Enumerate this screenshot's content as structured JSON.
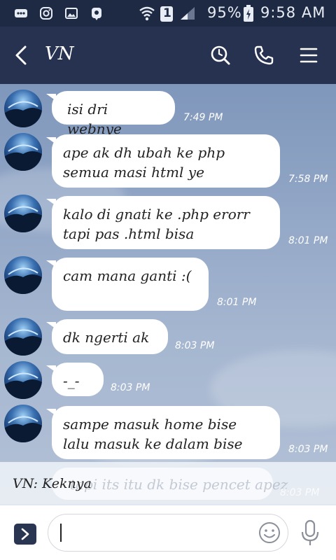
{
  "status_bar": {
    "battery": "95%",
    "time": "9:58 AM",
    "sim": "1"
  },
  "header": {
    "title": "VN",
    "icons": [
      "back-arrow-icon",
      "search-icon",
      "phone-icon",
      "menu-icon"
    ]
  },
  "messages": [
    {
      "text_lines": [
        "isi dri webnye"
      ],
      "time": "7:49 PM"
    },
    {
      "text_lines": [
        "ape ak dh ubah ke php",
        "semua masi html ye"
      ],
      "time": "7:58 PM"
    },
    {
      "text_lines": [
        "kalo di gnati ke .php erorr",
        "tapi pas  .html bisa"
      ],
      "time": "8:01 PM"
    },
    {
      "text_lines": [
        "cam mana ganti :("
      ],
      "time": "8:01 PM"
    },
    {
      "text_lines": [
        "dk ngerti ak"
      ],
      "time": "8:03 PM"
    },
    {
      "text_lines": [
        "-_-"
      ],
      "time": "8:03 PM"
    },
    {
      "text_lines": [
        "sampe masuk  home bise",
        "lalu masuk ke dalam bise"
      ],
      "time": "8:03 PM"
    }
  ],
  "typing": {
    "label": "VN: Keknya",
    "ghost_text": "tapi its itu dk bise pencet apez",
    "ghost_time": "8:03 PM"
  },
  "input": {
    "placeholder": ""
  },
  "colors": {
    "status_bar": "#1e2a44",
    "header": "#26324f",
    "bubble": "#ffffff",
    "expand_button": "#2a3552"
  }
}
